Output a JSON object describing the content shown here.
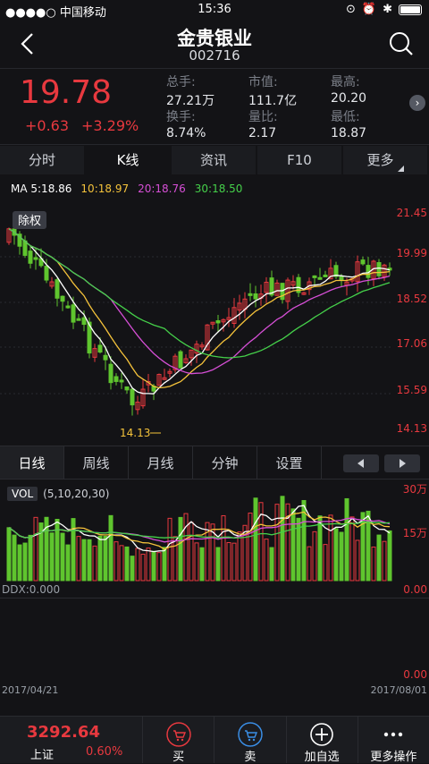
{
  "status_bar": {
    "carrier": "●●●●○ 中国移动",
    "time": "15:36"
  },
  "header": {
    "title": "金贵银业",
    "code": "002716"
  },
  "quote": {
    "price": "19.78",
    "change": "+0.63",
    "change_pct": "+3.29%",
    "stats": [
      {
        "label": "总手:",
        "value": "27.21万"
      },
      {
        "label": "市值:",
        "value": "111.7亿"
      },
      {
        "label": "最高:",
        "value": "20.20"
      },
      {
        "label": "换手:",
        "value": "8.74%"
      },
      {
        "label": "量比:",
        "value": "2.17"
      },
      {
        "label": "最低:",
        "value": "18.87"
      }
    ]
  },
  "tabs": [
    "分时",
    "K线",
    "资讯",
    "F10",
    "更多"
  ],
  "ma_legend": {
    "ma5": "MA 5:18.86",
    "ma10": "10:18.97",
    "ma20": "20:18.76",
    "ma30": "30:18.50"
  },
  "kline": {
    "badge": "除权",
    "low_marker": "14.13",
    "axis": [
      "21.45",
      "19.99",
      "18.52",
      "17.06",
      "15.59",
      "14.13"
    ]
  },
  "periods": [
    "日线",
    "周线",
    "月线",
    "分钟",
    "设置"
  ],
  "volume": {
    "tag": "VOL",
    "params": "(5,10,20,30)",
    "axis_top": "30万",
    "axis_mid": "15万"
  },
  "ddx": {
    "label": "DDX:0.000",
    "axis_top": "0.00",
    "axis_bottom": "0.00"
  },
  "dates": {
    "start": "2017/04/21",
    "end": "2017/08/01"
  },
  "bottom": {
    "index_value": "3292.64",
    "index_name": "上证",
    "index_pct": "0.60%",
    "buy": "买",
    "sell": "卖",
    "add": "加自选",
    "more": "更多操作"
  },
  "colors": {
    "up": "#e8393f",
    "down": "#5fc52e",
    "ma5": "#ffffff",
    "ma10": "#f5c33b",
    "ma20": "#d64fd6",
    "ma30": "#45d04a"
  }
}
